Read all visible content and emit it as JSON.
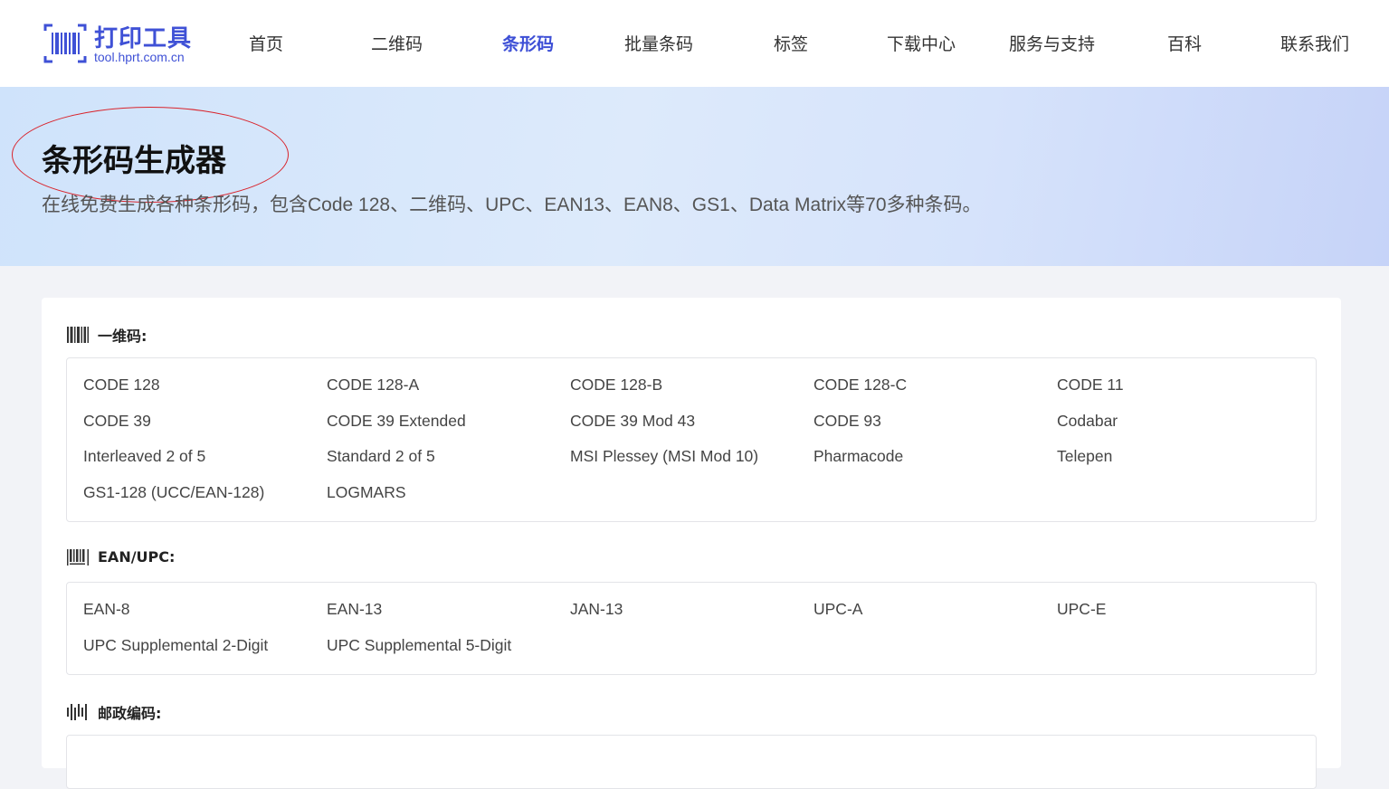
{
  "brand": {
    "title": "打印工具",
    "domain": "tool.hprt.com.cn",
    "color": "#3f51d6"
  },
  "nav": {
    "items": [
      {
        "label": "首页",
        "active": false
      },
      {
        "label": "二维码",
        "active": false
      },
      {
        "label": "条形码",
        "active": true
      },
      {
        "label": "批量条码",
        "active": false
      },
      {
        "label": "标签",
        "active": false
      },
      {
        "label": "下载中心",
        "active": false
      },
      {
        "label": "服务与支持",
        "active": false
      },
      {
        "label": "百科",
        "active": false
      },
      {
        "label": "联系我们",
        "active": false
      }
    ]
  },
  "banner": {
    "title": "条形码生成器",
    "subtitle": "在线免费生成各种条形码，包含Code 128、二维码、UPC、EAN13、EAN8、GS1、Data Matrix等70多种条码。",
    "highlight_color": "#d9242c"
  },
  "sections": [
    {
      "icon": "barcode-1d-icon",
      "label": "一维码:",
      "items": [
        "CODE 128",
        "CODE 128-A",
        "CODE 128-B",
        "CODE 128-C",
        "CODE 11",
        "CODE 39",
        "CODE 39 Extended",
        "CODE 39 Mod 43",
        "CODE 93",
        "Codabar",
        "Interleaved 2 of 5",
        "Standard 2 of 5",
        "MSI Plessey (MSI Mod 10)",
        "Pharmacode",
        "Telepen",
        "GS1-128 (UCC/EAN-128)",
        "LOGMARS"
      ]
    },
    {
      "icon": "barcode-ean-icon",
      "label": "EAN/UPC:",
      "items": [
        "EAN-8",
        "EAN-13",
        "JAN-13",
        "UPC-A",
        "UPC-E",
        "UPC Supplemental 2-Digit",
        "UPC Supplemental 5-Digit"
      ]
    },
    {
      "icon": "postal-barcode-icon",
      "label": "邮政编码:",
      "items": []
    }
  ]
}
